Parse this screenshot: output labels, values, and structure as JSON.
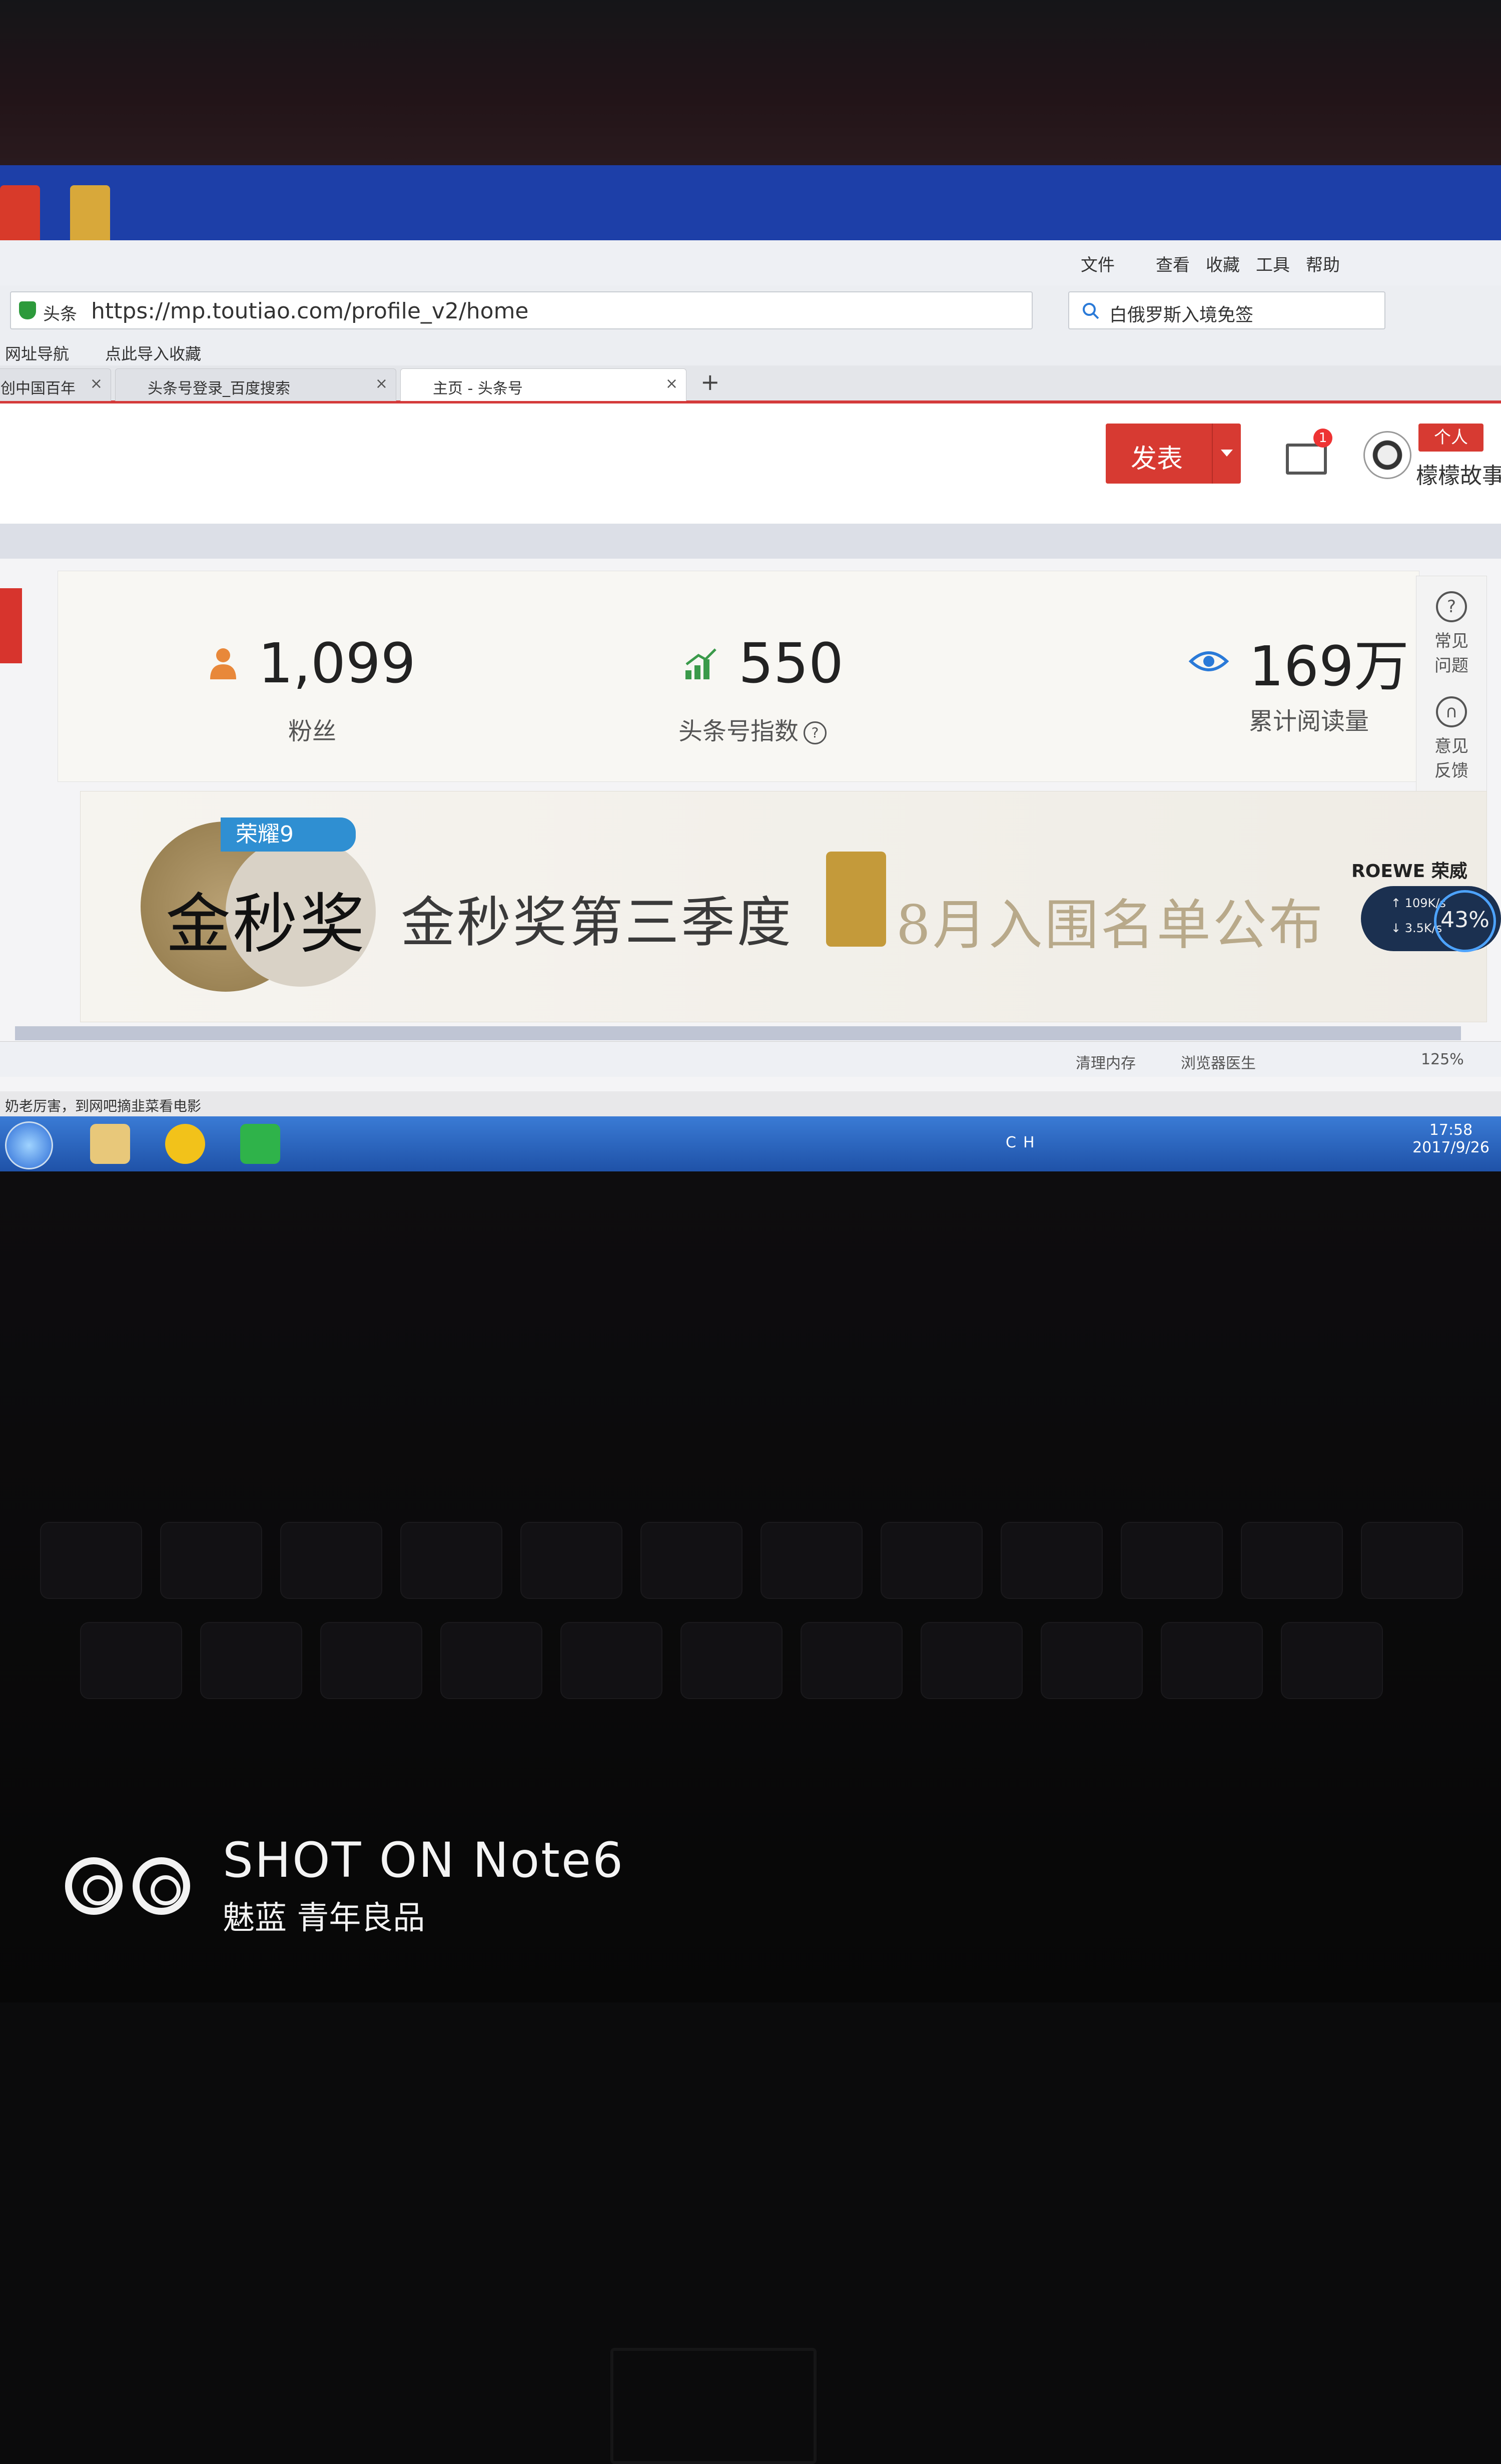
{
  "browser": {
    "menu": [
      "文件",
      "查看",
      "收藏",
      "工具",
      "帮助"
    ],
    "site_tag": "头条",
    "url": "https://mp.toutiao.com/profile_v2/home",
    "search_text": "白俄罗斯入境免签",
    "bookmarks": [
      "网址导航",
      "点此导入收藏"
    ],
    "tabs": [
      {
        "label": "创中国百年"
      },
      {
        "label": "头条号登录_百度搜索"
      },
      {
        "label": "主页 - 头条号"
      }
    ],
    "close_glyph": "×",
    "add_tab_glyph": "+"
  },
  "header": {
    "publish_label": "发表",
    "mail_badge": "1",
    "role_tag": "个人",
    "username": "檬檬故事"
  },
  "stats": [
    {
      "icon": "person-icon",
      "value": "1,099",
      "label": "粉丝"
    },
    {
      "icon": "growth-chart-icon",
      "value": "550",
      "label": "头条号指数"
    },
    {
      "icon": "eye-icon",
      "value": "169万",
      "label": "累计阅读量"
    }
  ],
  "side_float": {
    "faq": "常见问题",
    "feedback": "意见反馈",
    "faq_glyph": "?",
    "feedback_glyph": "∩"
  },
  "banner": {
    "brand_tag": "荣耀9",
    "medal_title": "金秒奖",
    "headline": "金秒奖第三季度",
    "subline": "8月入围名单公布",
    "sponsor": "ROEWE 荣威"
  },
  "speed_widget": {
    "up": "↑ 109K/s",
    "down": "↓ 3.5K/s",
    "percent": "43%"
  },
  "statusbar": {
    "clean_memory": "清理内存",
    "browser_doctor": "浏览器医生",
    "zoom": "125%"
  },
  "taskbar": {
    "ticker": "奶老厉害，到网吧摘韭菜看电影",
    "tray_text": "CH",
    "time": "17:58",
    "date": "2017/9/26"
  },
  "watermark": {
    "title": "SHOT ON Note6",
    "subtitle": "魅蓝 青年良品"
  },
  "colors": {
    "accent_red": "#d73a32",
    "stat_person": "#e8883a",
    "stat_growth": "#3a9a4a",
    "stat_eye": "#2a7ad8"
  }
}
